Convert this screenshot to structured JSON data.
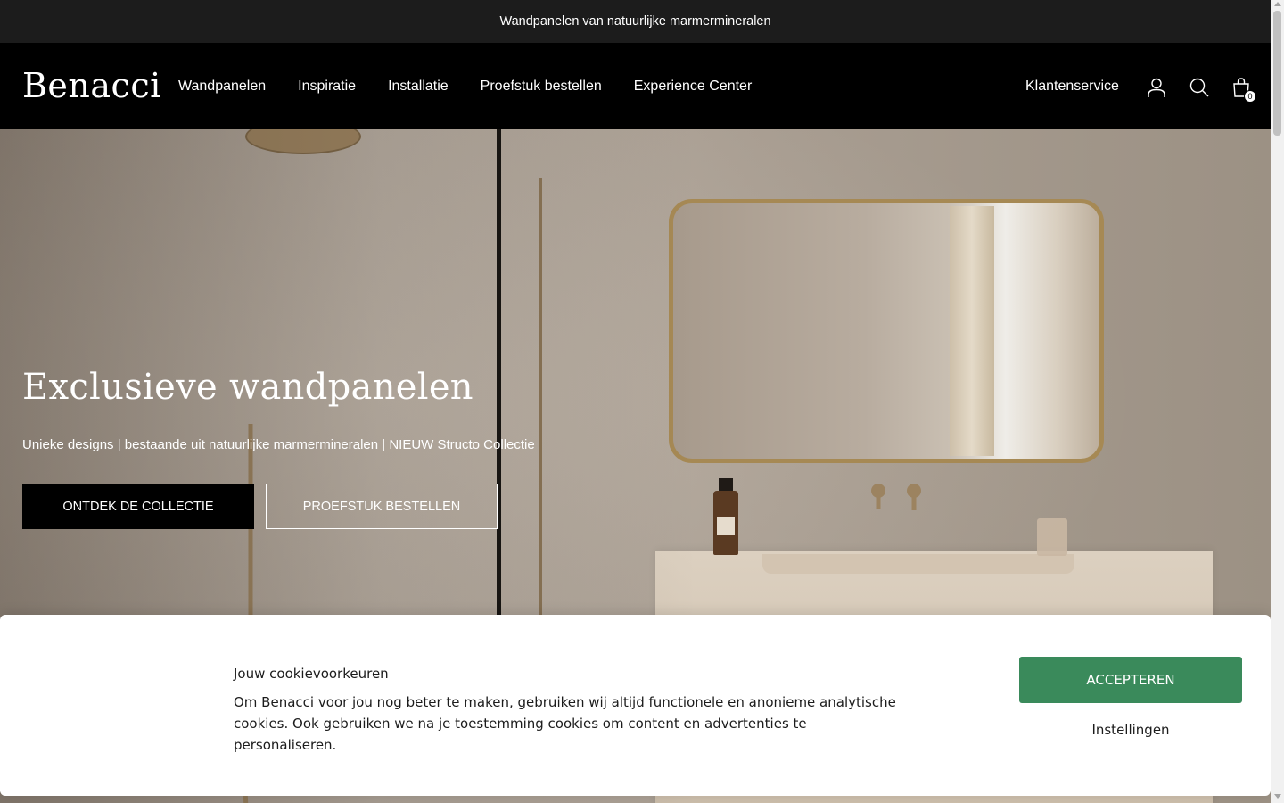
{
  "announcement": {
    "text": "Wandpanelen van natuurlijke marmermineralen"
  },
  "header": {
    "logo": "Benacci",
    "nav": [
      "Wandpanelen",
      "Inspiratie",
      "Installatie",
      "Proefstuk bestellen",
      "Experience Center"
    ],
    "customer_service": "Klantenservice",
    "icons": [
      "account-icon",
      "search-icon",
      "cart-icon"
    ],
    "cart_count": "0"
  },
  "hero": {
    "title": "Exclusieve wandpanelen",
    "subtitle": "Unieke designs | bestaande uit natuurlijke marmermineralen | NIEUW Structo Collectie",
    "primary_button": "ONTDEK DE COLLECTIE",
    "secondary_button": "PROEFSTUK BESTELLEN"
  },
  "cookie_banner": {
    "title": "Jouw cookievoorkeuren",
    "text": "Om Benacci voor jou nog beter te maken, gebruiken wij altijd functionele en anonieme analytische cookies. Ook gebruiken we na je toestemming cookies om content en advertenties te personaliseren.",
    "accept_button": "ACCEPTEREN",
    "settings_link": "Instellingen"
  },
  "colors": {
    "announcement_bg": "#1c1c1c",
    "header_bg": "#000000",
    "accept_green": "#3a8a5b"
  }
}
